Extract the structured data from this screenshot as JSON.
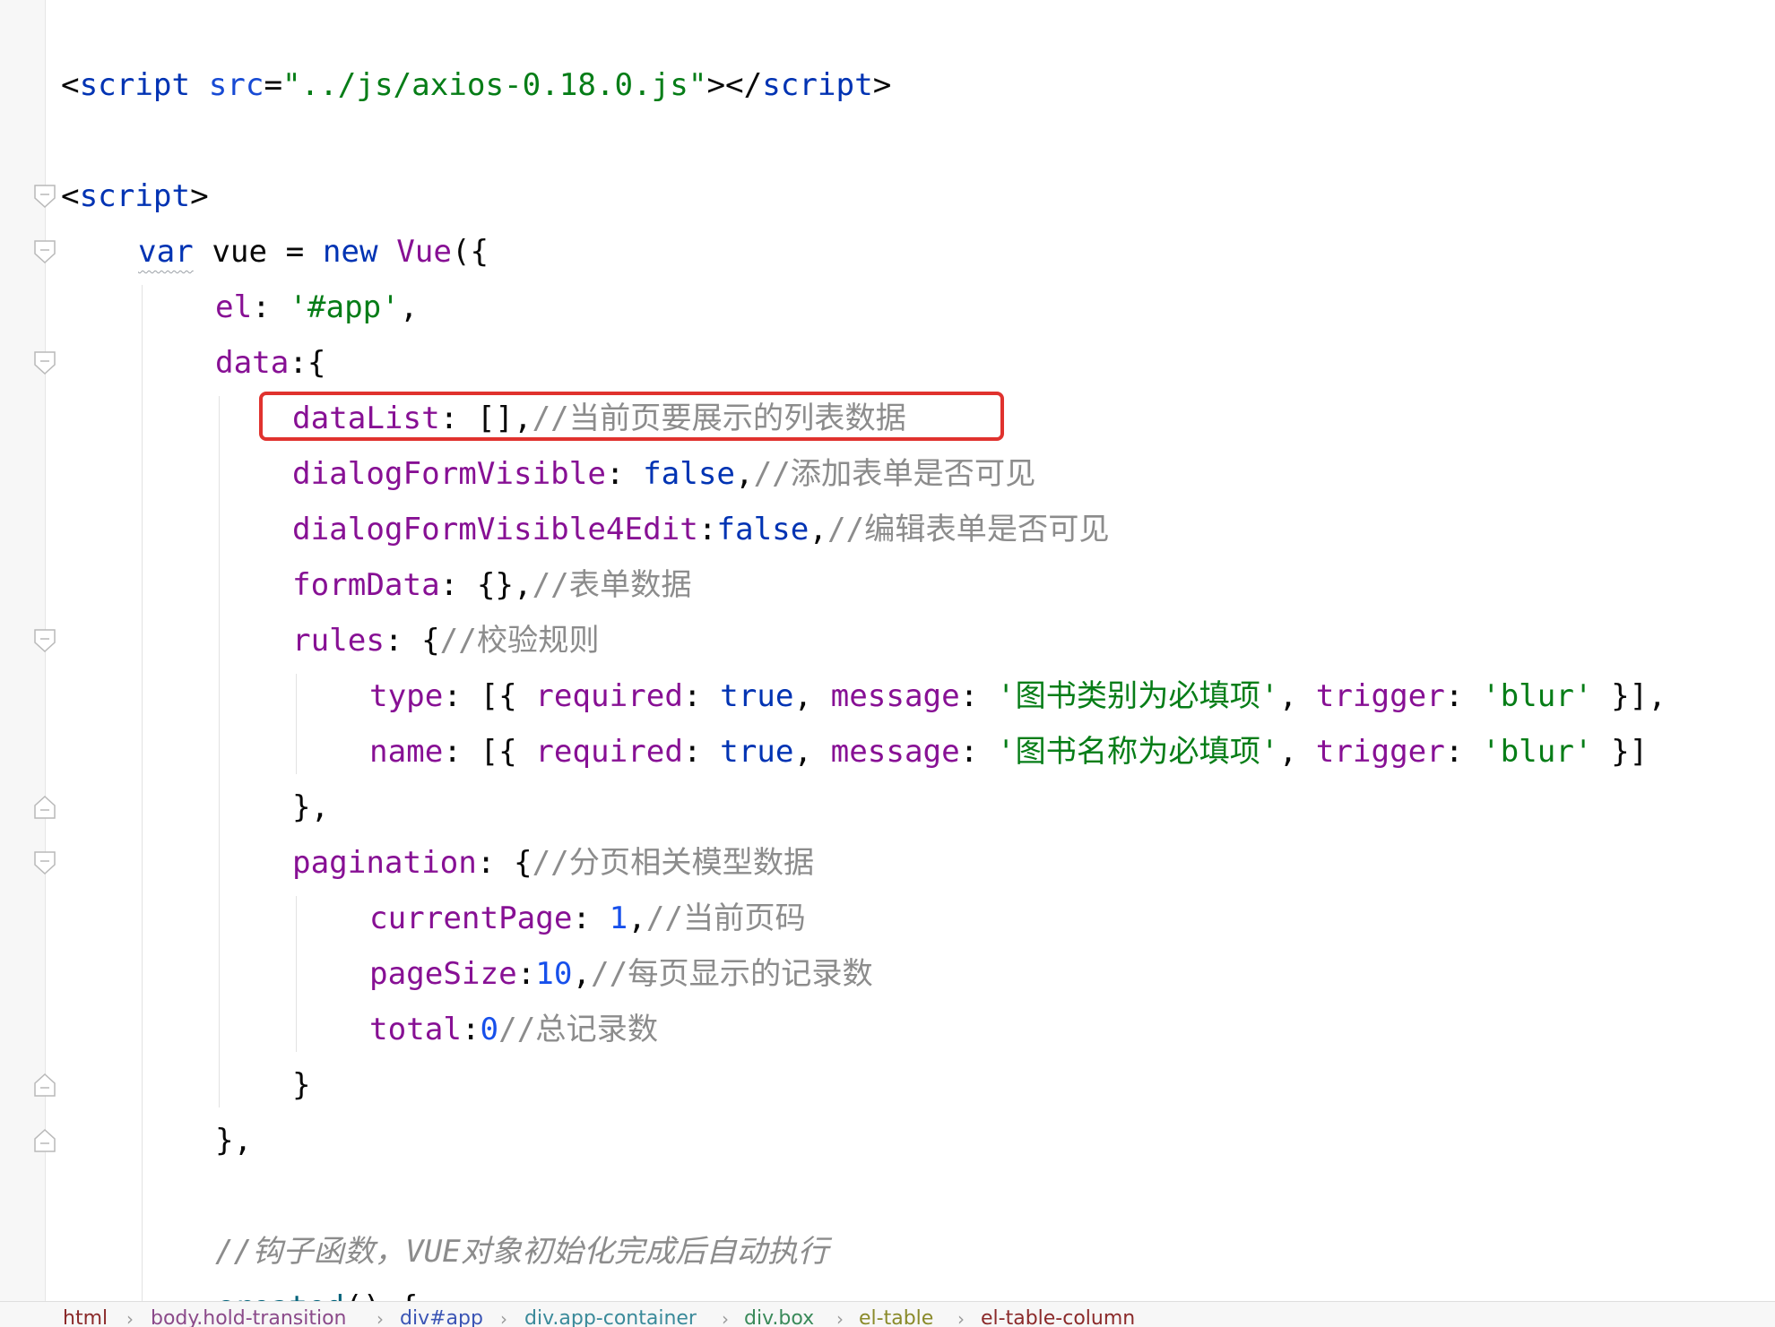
{
  "editor": {
    "lines": [
      {
        "indent": 0,
        "tokens": [
          {
            "t": "<",
            "c": ""
          },
          {
            "t": "script",
            "c": "tag"
          },
          {
            "t": " ",
            "c": ""
          },
          {
            "t": "src",
            "c": "attr"
          },
          {
            "t": "=",
            "c": ""
          },
          {
            "t": "\"../js/axios-0.18.0.js\"",
            "c": "str"
          },
          {
            "t": "></",
            "c": ""
          },
          {
            "t": "script",
            "c": "tag"
          },
          {
            "t": ">",
            "c": ""
          }
        ]
      },
      {
        "indent": 0,
        "tokens": []
      },
      {
        "indent": 0,
        "tokens": [
          {
            "t": "<",
            "c": ""
          },
          {
            "t": "script",
            "c": "tag"
          },
          {
            "t": ">",
            "c": ""
          }
        ]
      },
      {
        "indent": 4,
        "tokens": [
          {
            "t": "var",
            "c": "kw squiggle"
          },
          {
            "t": " vue = ",
            "c": ""
          },
          {
            "t": "new",
            "c": "kw"
          },
          {
            "t": " ",
            "c": ""
          },
          {
            "t": "Vue",
            "c": "prop"
          },
          {
            "t": "({",
            "c": ""
          }
        ]
      },
      {
        "indent": 8,
        "tokens": [
          {
            "t": "el",
            "c": "prop"
          },
          {
            "t": ": ",
            "c": ""
          },
          {
            "t": "'#app'",
            "c": "str"
          },
          {
            "t": ",",
            "c": ""
          }
        ]
      },
      {
        "indent": 8,
        "tokens": [
          {
            "t": "data",
            "c": "prop"
          },
          {
            "t": ":{",
            "c": ""
          }
        ]
      },
      {
        "indent": 12,
        "tokens": [
          {
            "t": "dataList",
            "c": "prop"
          },
          {
            "t": ": [],",
            "c": ""
          },
          {
            "t": "//当前页要展示的列表数据",
            "c": "cm"
          }
        ]
      },
      {
        "indent": 12,
        "tokens": [
          {
            "t": "dialogFormVisible",
            "c": "prop"
          },
          {
            "t": ": ",
            "c": ""
          },
          {
            "t": "false",
            "c": "kw"
          },
          {
            "t": ",",
            "c": ""
          },
          {
            "t": "//添加表单是否可见",
            "c": "cm"
          }
        ]
      },
      {
        "indent": 12,
        "tokens": [
          {
            "t": "dialogFormVisible4Edit",
            "c": "prop"
          },
          {
            "t": ":",
            "c": ""
          },
          {
            "t": "false",
            "c": "kw"
          },
          {
            "t": ",",
            "c": ""
          },
          {
            "t": "//编辑表单是否可见",
            "c": "cm"
          }
        ]
      },
      {
        "indent": 12,
        "tokens": [
          {
            "t": "formData",
            "c": "prop"
          },
          {
            "t": ": {},",
            "c": ""
          },
          {
            "t": "//表单数据",
            "c": "cm"
          }
        ]
      },
      {
        "indent": 12,
        "tokens": [
          {
            "t": "rules",
            "c": "prop"
          },
          {
            "t": ": {",
            "c": ""
          },
          {
            "t": "//校验规则",
            "c": "cm"
          }
        ]
      },
      {
        "indent": 16,
        "tokens": [
          {
            "t": "type",
            "c": "prop"
          },
          {
            "t": ": [{ ",
            "c": ""
          },
          {
            "t": "required",
            "c": "prop"
          },
          {
            "t": ": ",
            "c": ""
          },
          {
            "t": "true",
            "c": "kw"
          },
          {
            "t": ", ",
            "c": ""
          },
          {
            "t": "message",
            "c": "prop"
          },
          {
            "t": ": ",
            "c": ""
          },
          {
            "t": "'图书类别为必填项'",
            "c": "str"
          },
          {
            "t": ", ",
            "c": ""
          },
          {
            "t": "trigger",
            "c": "prop"
          },
          {
            "t": ": ",
            "c": ""
          },
          {
            "t": "'blur'",
            "c": "str"
          },
          {
            "t": " }],",
            "c": ""
          }
        ]
      },
      {
        "indent": 16,
        "tokens": [
          {
            "t": "name",
            "c": "prop"
          },
          {
            "t": ": [{ ",
            "c": ""
          },
          {
            "t": "required",
            "c": "prop"
          },
          {
            "t": ": ",
            "c": ""
          },
          {
            "t": "true",
            "c": "kw"
          },
          {
            "t": ", ",
            "c": ""
          },
          {
            "t": "message",
            "c": "prop"
          },
          {
            "t": ": ",
            "c": ""
          },
          {
            "t": "'图书名称为必填项'",
            "c": "str"
          },
          {
            "t": ", ",
            "c": ""
          },
          {
            "t": "trigger",
            "c": "prop"
          },
          {
            "t": ": ",
            "c": ""
          },
          {
            "t": "'blur'",
            "c": "str"
          },
          {
            "t": " }]",
            "c": ""
          }
        ]
      },
      {
        "indent": 12,
        "tokens": [
          {
            "t": "},",
            "c": ""
          }
        ]
      },
      {
        "indent": 12,
        "tokens": [
          {
            "t": "pagination",
            "c": "prop"
          },
          {
            "t": ": {",
            "c": ""
          },
          {
            "t": "//分页相关模型数据",
            "c": "cm"
          }
        ]
      },
      {
        "indent": 16,
        "tokens": [
          {
            "t": "currentPage",
            "c": "prop"
          },
          {
            "t": ": ",
            "c": ""
          },
          {
            "t": "1",
            "c": "num"
          },
          {
            "t": ",",
            "c": ""
          },
          {
            "t": "//当前页码",
            "c": "cm"
          }
        ]
      },
      {
        "indent": 16,
        "tokens": [
          {
            "t": "pageSize",
            "c": "prop"
          },
          {
            "t": ":",
            "c": ""
          },
          {
            "t": "10",
            "c": "num"
          },
          {
            "t": ",",
            "c": ""
          },
          {
            "t": "//每页显示的记录数",
            "c": "cm"
          }
        ]
      },
      {
        "indent": 16,
        "tokens": [
          {
            "t": "total",
            "c": "prop"
          },
          {
            "t": ":",
            "c": ""
          },
          {
            "t": "0",
            "c": "num"
          },
          {
            "t": "//总记录数",
            "c": "cm"
          }
        ]
      },
      {
        "indent": 12,
        "tokens": [
          {
            "t": "}",
            "c": ""
          }
        ]
      },
      {
        "indent": 8,
        "tokens": [
          {
            "t": "},",
            "c": ""
          }
        ]
      },
      {
        "indent": 0,
        "tokens": []
      },
      {
        "indent": 8,
        "tokens": [
          {
            "t": "//钩子函数，",
            "c": "cmi"
          },
          {
            "t": "VUE",
            "c": "cmi"
          },
          {
            "t": "对象初始化完成后自动执行",
            "c": "cmi"
          }
        ]
      },
      {
        "indent": 8,
        "tokens": [
          {
            "t": "created",
            "c": "fn"
          },
          {
            "t": "() {",
            "c": ""
          }
        ]
      }
    ]
  },
  "breadcrumb": {
    "items": [
      {
        "label": "html",
        "color": "#8b2a2a"
      },
      {
        "label": "body.hold-transition",
        "color": "#8b4a8a"
      },
      {
        "label": "div#app",
        "color": "#3b55b5"
      },
      {
        "label": "div.app-container",
        "color": "#3a8a9a"
      },
      {
        "label": "div.box",
        "color": "#3a8a5a"
      },
      {
        "label": "el-table",
        "color": "#8a8a2a"
      },
      {
        "label": "el-table-column",
        "color": "#8b2a2a"
      }
    ],
    "separator": "›"
  },
  "colors": {
    "highlight_box": "#e0322e",
    "keyword": "#0033b3",
    "property": "#871094",
    "string": "#067d17",
    "comment": "#8c8c8c",
    "number": "#1750eb"
  }
}
